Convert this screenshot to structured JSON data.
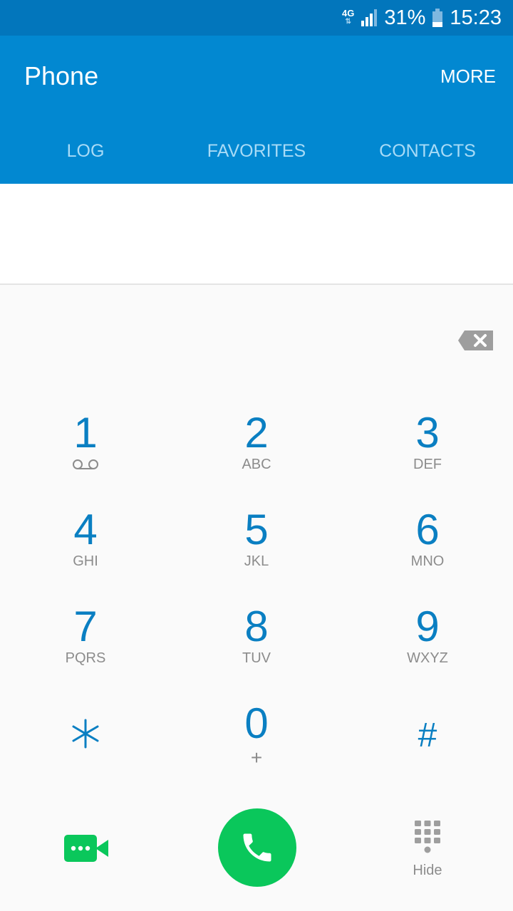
{
  "status_bar": {
    "network": "4G",
    "battery_percent_label": "31%",
    "battery_level": 0.31,
    "time": "15:23"
  },
  "app_bar": {
    "title": "Phone",
    "more_label": "MORE"
  },
  "tabs": [
    {
      "label": "LOG"
    },
    {
      "label": "FAVORITES"
    },
    {
      "label": "CONTACTS"
    }
  ],
  "display": {
    "number": ""
  },
  "keypad": [
    {
      "digit": "1",
      "letters": "",
      "icon": "voicemail-icon"
    },
    {
      "digit": "2",
      "letters": "ABC"
    },
    {
      "digit": "3",
      "letters": "DEF"
    },
    {
      "digit": "4",
      "letters": "GHI"
    },
    {
      "digit": "5",
      "letters": "JKL"
    },
    {
      "digit": "6",
      "letters": "MNO"
    },
    {
      "digit": "7",
      "letters": "PQRS"
    },
    {
      "digit": "8",
      "letters": "TUV"
    },
    {
      "digit": "9",
      "letters": "WXYZ"
    },
    {
      "digit": "*",
      "letters": ""
    },
    {
      "digit": "0",
      "letters": "+"
    },
    {
      "digit": "#",
      "letters": ""
    }
  ],
  "actions": {
    "video_call_icon": "video-call-icon",
    "call_icon": "phone-icon",
    "hide_label": "Hide"
  },
  "colors": {
    "status_bar": "#0276bc",
    "app_bar": "#0288d1",
    "digit": "#0a7fc2",
    "call_green": "#0ac75b"
  }
}
